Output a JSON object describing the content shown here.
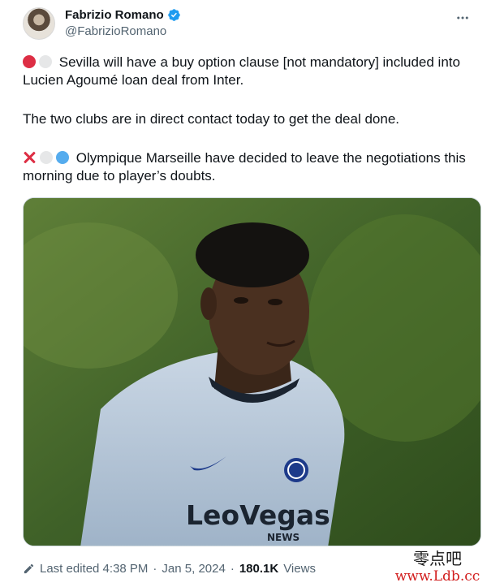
{
  "author": {
    "display_name": "Fabrizio Romano",
    "handle": "@FabrizioRomano",
    "verified_icon": "verified-badge-icon",
    "avatar_icon": "avatar"
  },
  "menu": {
    "icon": "more-horizontal-icon"
  },
  "tweet": {
    "paragraphs": [
      {
        "emojis": [
          "red-circle",
          "white-circle"
        ],
        "text": "Sevilla will have a buy option clause [not mandatory] included into Lucien Agoumé loan deal from Inter."
      },
      {
        "emojis": [],
        "text": "The two clubs are in direct contact today to get the deal done."
      },
      {
        "emojis": [
          "cross-mark",
          "white-circle",
          "blue-circle"
        ],
        "text": "Olympique Marseille have decided to leave the negotiations this morning due to player’s doubts."
      }
    ]
  },
  "media": {
    "shirt_sponsor": "LeoVegas",
    "shirt_sponsor_sub": "NEWS"
  },
  "footer": {
    "edit_icon": "pencil-icon",
    "edited_label": "Last edited 4:38 PM",
    "separator": "·",
    "date": "Jan 5, 2024",
    "views_count": "180.1K",
    "views_label": "Views"
  },
  "watermark": {
    "chinese": "零点吧",
    "url": "www.Ldb.cc"
  },
  "colors": {
    "text": "#0f1419",
    "secondary": "#536471",
    "verified": "#1d9bf0",
    "watermark_url": "#d21f1f"
  }
}
